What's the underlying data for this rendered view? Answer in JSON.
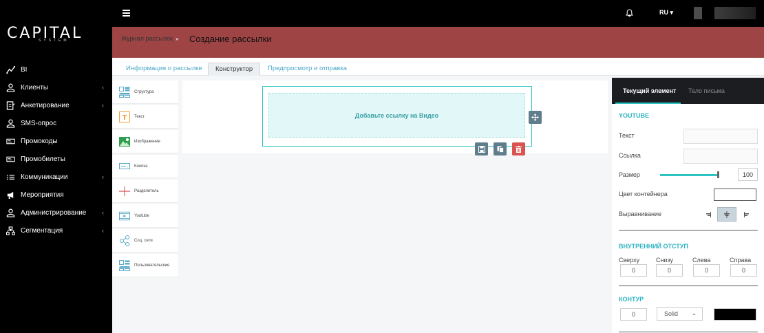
{
  "brand": {
    "logo_text": "CAPITAL",
    "logo_sub": "SYSTEM"
  },
  "topbar": {
    "lang": "RU ▾"
  },
  "sidebar": {
    "items": [
      {
        "label": "BI",
        "icon": "trend-icon",
        "has_arrow": false
      },
      {
        "label": "Клиенты",
        "icon": "user-icon",
        "has_arrow": true
      },
      {
        "label": "Анкетирование",
        "icon": "form-icon",
        "has_arrow": true
      },
      {
        "label": "SMS-опрос",
        "icon": "user-icon",
        "has_arrow": false
      },
      {
        "label": "Промокоды",
        "icon": "ticket-icon",
        "has_arrow": false
      },
      {
        "label": "Промобилеты",
        "icon": "ticket-icon",
        "has_arrow": false
      },
      {
        "label": "Коммуникации",
        "icon": "list-icon",
        "has_arrow": true
      },
      {
        "label": "Мероприятия",
        "icon": "megaphone-icon",
        "has_arrow": false
      },
      {
        "label": "Администрирование",
        "icon": "user-icon",
        "has_arrow": true
      },
      {
        "label": "Сегментация",
        "icon": "hierarchy-icon",
        "has_arrow": true
      }
    ],
    "arrow": "‹"
  },
  "header": {
    "breadcrumb": "Журнал рассылок",
    "breadcrumb_sep": "»",
    "title": "Создание рассылки"
  },
  "tabs": [
    {
      "label": "Информация о рассылке",
      "active": false
    },
    {
      "label": "Конструктор",
      "active": true
    },
    {
      "label": "Предпросмотр и отправка",
      "active": false
    }
  ],
  "palette": [
    {
      "label": "Структура",
      "icon": "structure-icon"
    },
    {
      "label": "Текст",
      "icon": "text-icon"
    },
    {
      "label": "Изображение",
      "icon": "image-icon"
    },
    {
      "label": "Кнопка",
      "icon": "button-icon"
    },
    {
      "label": "Разделитель",
      "icon": "divider-icon"
    },
    {
      "label": "Youtube",
      "icon": "youtube-icon"
    },
    {
      "label": "Соц. сети",
      "icon": "share-icon"
    },
    {
      "label": "Пользовательские",
      "icon": "custom-icon"
    }
  ],
  "canvas": {
    "video_placeholder": "Добавьте ссылку на Видео"
  },
  "panel": {
    "tabs": [
      {
        "label": "Текущий элемент",
        "active": true
      },
      {
        "label": "Тело письма",
        "active": false
      }
    ],
    "section_youtube": "YOUTUBE",
    "text_label": "Текст",
    "link_label": "Ссылка",
    "size_label": "Размер",
    "size_value": "100",
    "container_color_label": "Цвет контейнера",
    "align_label": "Выравнивание",
    "section_padding": "ВНУТРЕННИЙ ОТСТУП",
    "padding": [
      {
        "label": "Сверху",
        "value": "0"
      },
      {
        "label": "Снизу",
        "value": "0"
      },
      {
        "label": "Слева",
        "value": "0"
      },
      {
        "label": "Справа",
        "value": "0"
      }
    ],
    "section_border": "КОНТУР",
    "border_width": "0",
    "border_style": "Solid",
    "border_color": "#000000",
    "accent_color": "#2bc3c3"
  }
}
